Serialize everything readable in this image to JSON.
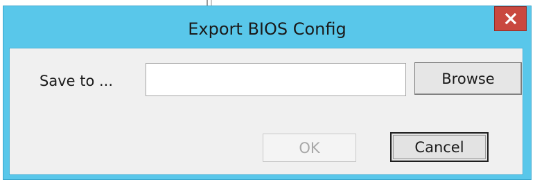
{
  "dialog": {
    "title": "Export BIOS Config",
    "close_icon": "close-icon",
    "title_bar_color": "#59c7ea",
    "close_button_color": "#c9483f"
  },
  "form": {
    "save_label": "Save to ...",
    "path_value": "",
    "browse_label": "Browse"
  },
  "actions": {
    "ok_label": "OK",
    "ok_enabled": false,
    "cancel_label": "Cancel"
  }
}
